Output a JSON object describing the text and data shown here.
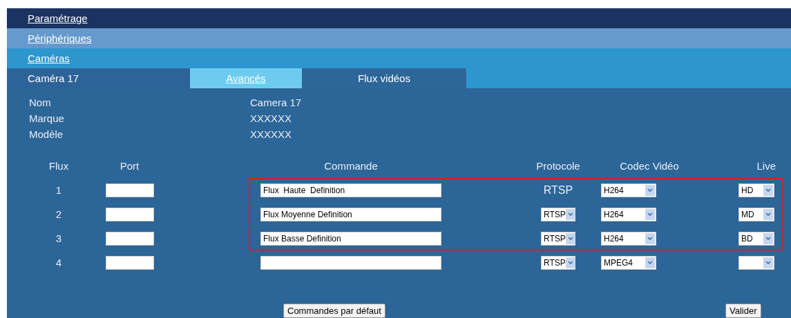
{
  "breadcrumbs": [
    {
      "label": "Paramétrage"
    },
    {
      "label": "Périphériques"
    },
    {
      "label": "Caméras"
    }
  ],
  "camera_title": "Caméra 17",
  "tabs": [
    {
      "label": "Avancés",
      "selected": false
    },
    {
      "label": "Flux vidéos",
      "selected": true
    }
  ],
  "info": [
    {
      "label": "Nom",
      "value": "Camera 17"
    },
    {
      "label": "Marque",
      "value": "XXXXXX"
    },
    {
      "label": "Modèle",
      "value": "XXXXXX"
    }
  ],
  "columns": [
    "Flux",
    "Port",
    "Commande",
    "Protocole",
    "Codec Vidéo",
    "Live"
  ],
  "streams": [
    {
      "number": "1",
      "command": "Flux  Haute  Definition",
      "protocol": {
        "kind": "text",
        "value": "RTSP"
      },
      "codec": "H264",
      "live": "HD",
      "highlighted": true
    },
    {
      "number": "2",
      "command": "Flux Moyenne Definition",
      "protocol": {
        "kind": "select",
        "value": "RTSP"
      },
      "codec": "H264",
      "live": "MD",
      "highlighted": true
    },
    {
      "number": "3",
      "command": "Flux Basse Definition",
      "protocol": {
        "kind": "select",
        "value": "RTSP"
      },
      "codec": "H264",
      "live": "BD",
      "highlighted": true
    },
    {
      "number": "4",
      "protocol": {
        "kind": "select",
        "value": "RTSP"
      },
      "codec": "MPEG4",
      "highlighted": false
    }
  ],
  "buttons": {
    "defaults": "Commandes par défaut",
    "submit": "Valider"
  }
}
